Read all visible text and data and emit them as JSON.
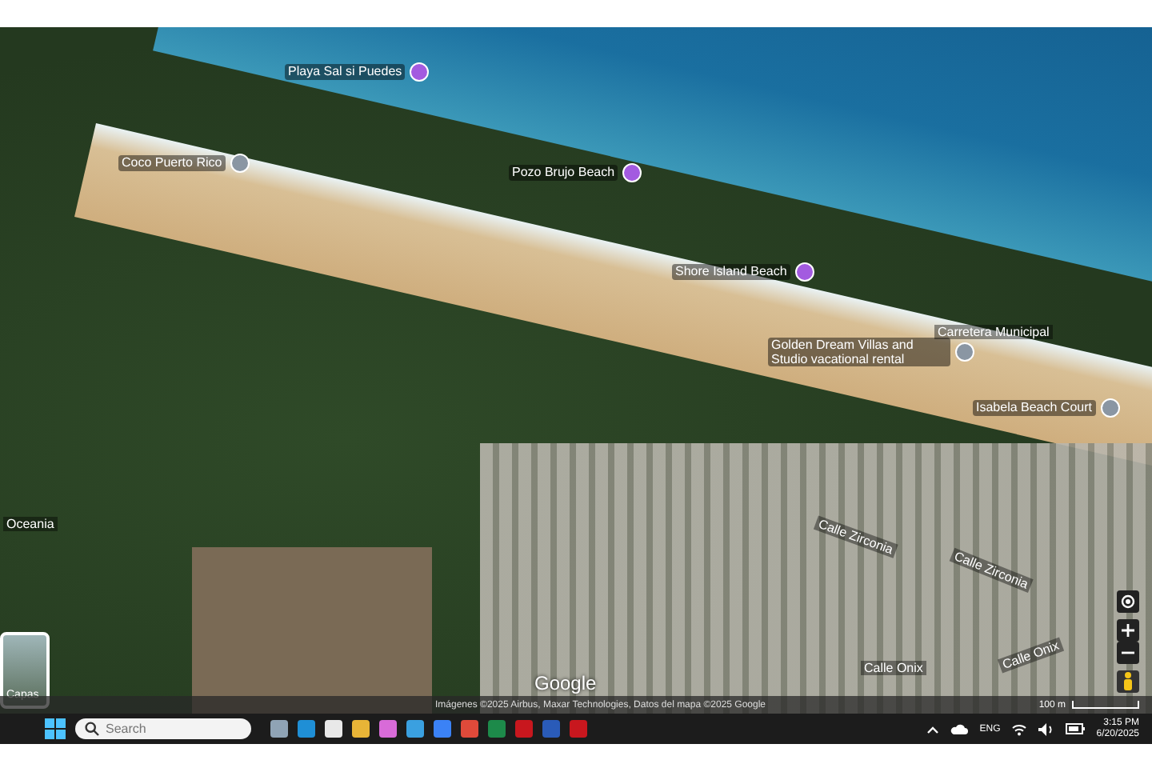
{
  "map": {
    "places": [
      {
        "text": "Playa Sal si Puedes",
        "color": "#a35be0"
      },
      {
        "text": "Coco Puerto Rico",
        "color": "#8a96a3"
      },
      {
        "text": "Pozo Brujo Beach",
        "color": "#a35be0"
      },
      {
        "text": "Shore Island Beach",
        "color": "#a35be0"
      },
      {
        "text": "Golden Dream Villas and Studio vacational rental",
        "color": "#8a96a3"
      },
      {
        "text": "Isabela Beach Court",
        "color": "#8a96a3"
      }
    ],
    "streets": [
      "Carretera Municipal",
      "Calle Zirconia",
      "Calle Zirconia",
      "Calle Onix",
      "Calle Onix",
      "Oceania"
    ],
    "layers_label": "Capas",
    "logo": "Google",
    "attribution": "Imágenes ©2025 Airbus, Maxar Technologies, Datos del mapa ©2025 Google",
    "scale": "100 m"
  },
  "taskbar": {
    "search_placeholder": "Search",
    "language": "ENG",
    "time": "3:15 PM",
    "date": "6/20/2025"
  }
}
